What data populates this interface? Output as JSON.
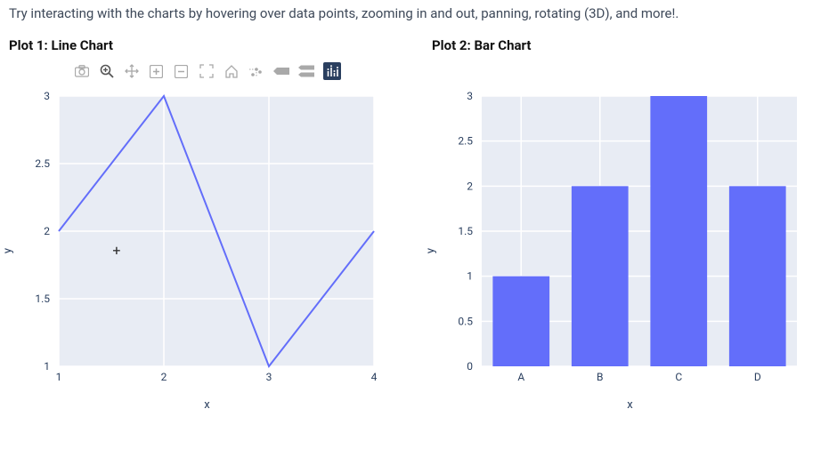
{
  "intro": "Try interacting with the charts by hovering over data points, zooming in and out, panning, rotating (3D), and more!.",
  "plots": {
    "left": {
      "title": "Plot 1: Line Chart",
      "xlabel": "x",
      "ylabel": "y"
    },
    "right": {
      "title": "Plot 2: Bar Chart",
      "xlabel": "x",
      "ylabel": "y"
    }
  },
  "modebar": {
    "buttons": [
      {
        "name": "camera-icon",
        "label": "Download plot as png"
      },
      {
        "name": "zoom-icon",
        "label": "Zoom"
      },
      {
        "name": "pan-icon",
        "label": "Pan"
      },
      {
        "name": "zoom-in-icon",
        "label": "Zoom in"
      },
      {
        "name": "zoom-out-icon",
        "label": "Zoom out"
      },
      {
        "name": "autoscale-icon",
        "label": "Autoscale"
      },
      {
        "name": "reset-axes-icon",
        "label": "Reset axes"
      },
      {
        "name": "spike-lines-icon",
        "label": "Toggle spike lines"
      },
      {
        "name": "hover-closest-icon",
        "label": "Show closest on hover"
      },
      {
        "name": "hover-compare-icon",
        "label": "Compare on hover"
      },
      {
        "name": "plotly-logo-icon",
        "label": "Plotly",
        "active": true
      }
    ]
  },
  "chart_data": [
    {
      "type": "line",
      "title": "Plot 1: Line Chart",
      "xlabel": "x",
      "ylabel": "y",
      "x": [
        1,
        2,
        3,
        4
      ],
      "y": [
        2,
        3,
        1,
        2
      ],
      "xlim": [
        1,
        4
      ],
      "ylim": [
        1,
        3
      ],
      "xticks": [
        1,
        2,
        3,
        4
      ],
      "yticks": [
        1,
        1.5,
        2,
        2.5,
        3
      ]
    },
    {
      "type": "bar",
      "title": "Plot 2: Bar Chart",
      "xlabel": "x",
      "ylabel": "y",
      "categories": [
        "A",
        "B",
        "C",
        "D"
      ],
      "values": [
        1,
        2,
        3,
        2
      ],
      "ylim": [
        0,
        3
      ],
      "yticks": [
        0,
        0.5,
        1,
        1.5,
        2,
        2.5,
        3
      ]
    }
  ]
}
